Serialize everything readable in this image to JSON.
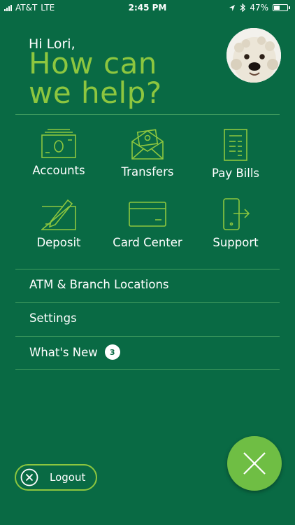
{
  "status_bar": {
    "carrier": "AT&T",
    "network": "LTE",
    "time": "2:45 PM",
    "battery": "47%",
    "battery_level": 0.47
  },
  "header": {
    "greeting": "Hi Lori,",
    "headline_line1": "How can",
    "headline_line2": "we help?"
  },
  "tiles": [
    {
      "label": "Accounts",
      "icon": "cash-icon"
    },
    {
      "label": "Transfers",
      "icon": "envelope-money-icon"
    },
    {
      "label": "Pay Bills",
      "icon": "bill-icon"
    },
    {
      "label": "Deposit",
      "icon": "check-pen-icon"
    },
    {
      "label": "Card Center",
      "icon": "credit-card-icon"
    },
    {
      "label": "Support",
      "icon": "phone-support-icon"
    }
  ],
  "menu": [
    {
      "label": "ATM & Branch Locations"
    },
    {
      "label": "Settings"
    },
    {
      "label": "What's New",
      "badge": "3"
    }
  ],
  "logout": {
    "label": "Logout"
  },
  "colors": {
    "background": "#096a44",
    "accent": "#8dc63f",
    "fab": "#6fbe44",
    "divider": "#3f9b5e"
  }
}
